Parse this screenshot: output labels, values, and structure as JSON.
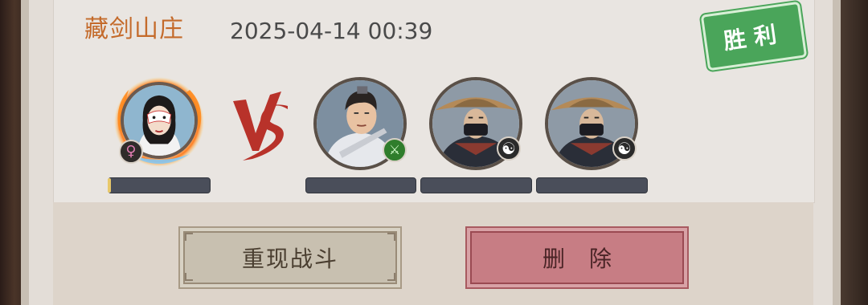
{
  "battle": {
    "location": "藏剑山庄",
    "datetime": "2025-04-14 00:39",
    "result_label": "胜利",
    "vs_label": "VS"
  },
  "player": {
    "avatar_icon": "masked-female-hero-portrait",
    "badge_icon": "female-symbol-icon",
    "badge_glyph": "♀"
  },
  "opponents": [
    {
      "avatar_icon": "swordsman-portrait",
      "badge_icon": "sword-icon",
      "badge_glyph": "⚔"
    },
    {
      "avatar_icon": "masked-bamboo-hat-assassin-portrait",
      "badge_icon": "yin-yang-icon",
      "badge_glyph": "☯"
    },
    {
      "avatar_icon": "masked-bamboo-hat-assassin-portrait",
      "badge_icon": "yin-yang-icon",
      "badge_glyph": "☯"
    }
  ],
  "actions": {
    "replay_label": "重现战斗",
    "delete_label": "删除"
  },
  "colors": {
    "location_text": "#c46a2a",
    "victory_stamp": "#4aa55a",
    "vs_red": "#b8322a",
    "replay_button": "#c8c0b0",
    "delete_button": "#c77d84"
  }
}
